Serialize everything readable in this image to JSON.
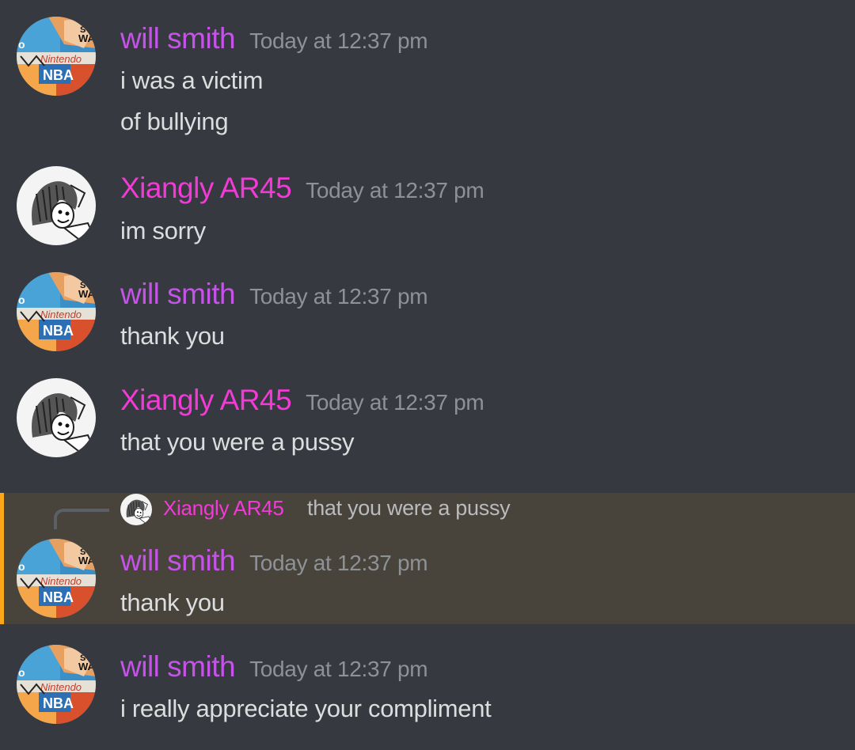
{
  "colors": {
    "background": "#36393f",
    "will_smith_name": "#c553e8",
    "xiangly_name": "#f23ad6",
    "timestamp": "#8e9297",
    "message_text": "#dcddde",
    "reply_highlight": "#48443c",
    "reply_accent": "#faa81a"
  },
  "messages": [
    {
      "author": "will smith",
      "timestamp": "Today at 12:37 pm",
      "lines": [
        "i was a victim",
        "of bullying"
      ],
      "avatar_icon": "collage-avatar-icon"
    },
    {
      "author": "Xiangly AR45",
      "timestamp": "Today at 12:37 pm",
      "lines": [
        "im sorry"
      ],
      "avatar_icon": "manga-avatar-icon"
    },
    {
      "author": "will smith",
      "timestamp": "Today at 12:37 pm",
      "lines": [
        "thank you"
      ],
      "avatar_icon": "collage-avatar-icon"
    },
    {
      "author": "Xiangly AR45",
      "timestamp": "Today at 12:37 pm",
      "lines": [
        "that you were a pussy"
      ],
      "avatar_icon": "manga-avatar-icon"
    },
    {
      "author": "will smith",
      "timestamp": "Today at 12:37 pm",
      "lines": [
        "thank you"
      ],
      "avatar_icon": "collage-avatar-icon",
      "reply_to": {
        "author": "Xiangly AR45",
        "text": "that you were a pussy",
        "avatar_icon": "manga-avatar-icon"
      }
    },
    {
      "author": "will smith",
      "timestamp": "Today at 12:37 pm",
      "lines": [
        "i really appreciate your compliment"
      ],
      "avatar_icon": "collage-avatar-icon"
    }
  ]
}
